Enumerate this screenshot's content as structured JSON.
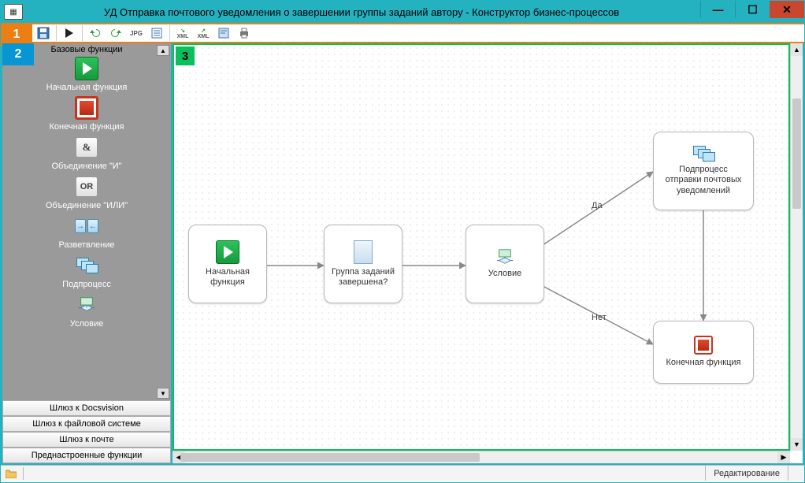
{
  "window": {
    "title": "УД Отправка почтового уведомления о завершении группы заданий автору - Конструктор бизнес-процессов"
  },
  "tags": {
    "t1": "1",
    "t2": "2",
    "t3": "3"
  },
  "palette": {
    "group_title": "Базовые функции",
    "items": [
      {
        "label": "Начальная функция"
      },
      {
        "label": "Конечная функция"
      },
      {
        "label": "Объединение \"И\""
      },
      {
        "label": "Объединение \"ИЛИ\""
      },
      {
        "label": "Разветвление"
      },
      {
        "label": "Подпроцесс"
      },
      {
        "label": "Условие"
      }
    ],
    "accordion": [
      "Шлюз к Docsvision",
      "Шлюз к файловой системе",
      "Шлюз к почте",
      "Преднастроенные функции"
    ]
  },
  "nodes": {
    "start": "Начальная функция",
    "group": "Группа заданий завершена?",
    "cond": "Условие",
    "sub": "Подпроцесс отправки почтовых уведомлений",
    "end": "Конечная функция"
  },
  "edges": {
    "yes": "Да",
    "no": "Нет"
  },
  "statusbar": {
    "mode": "Редактирование"
  },
  "and_glyph": "&",
  "or_glyph": "OR"
}
